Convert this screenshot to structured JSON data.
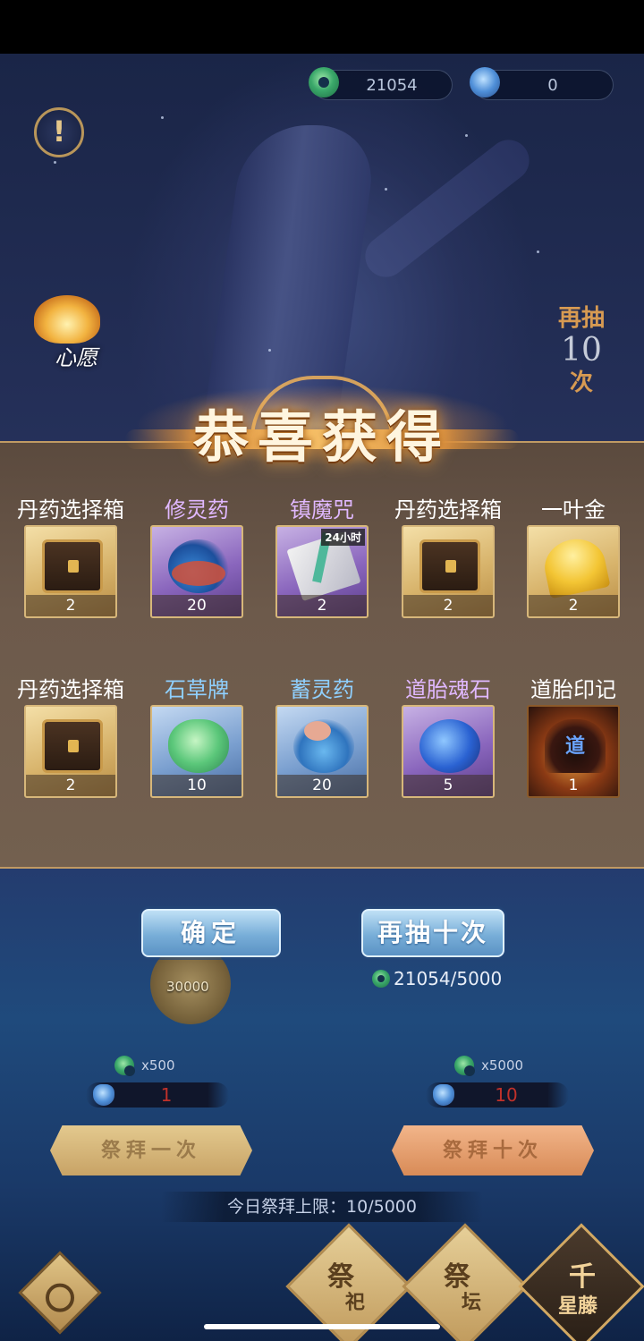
{
  "resources": {
    "jade_amount": "21054",
    "pouch_amount": "0"
  },
  "info_button": "!",
  "wish": {
    "label": "心愿"
  },
  "redraw_side": {
    "top": "再抽",
    "count": "10",
    "bottom": "次"
  },
  "result": {
    "title": "恭喜获得",
    "items": [
      {
        "name": "丹药选择箱",
        "count": "2",
        "rarity": "gold",
        "icon": "chest-icon"
      },
      {
        "name": "修灵药",
        "count": "20",
        "rarity": "purple",
        "icon": "potion-icon"
      },
      {
        "name": "镇魔咒",
        "count": "2",
        "rarity": "purple",
        "icon": "talisman-icon",
        "badge": "24小时"
      },
      {
        "name": "丹药选择箱",
        "count": "2",
        "rarity": "gold",
        "icon": "chest-icon"
      },
      {
        "name": "一叶金",
        "count": "2",
        "rarity": "gold",
        "icon": "ginkgo-leaf-icon"
      },
      {
        "name": "丹药选择箱",
        "count": "2",
        "rarity": "gold",
        "icon": "chest-icon"
      },
      {
        "name": "石草牌",
        "count": "10",
        "rarity": "blue",
        "icon": "jade-token-icon"
      },
      {
        "name": "蓄灵药",
        "count": "20",
        "rarity": "blue",
        "icon": "blue-potion-icon"
      },
      {
        "name": "道胎魂石",
        "count": "5",
        "rarity": "purple",
        "icon": "soul-stone-icon"
      },
      {
        "name": "道胎印记",
        "count": "1",
        "rarity": "dark",
        "icon": "dao-seal-icon"
      }
    ]
  },
  "actions": {
    "confirm": "确定",
    "redraw_ten": "再抽十次",
    "cost": "21054/5000"
  },
  "altar": {
    "coin_left": "30000",
    "price_one": "x500",
    "price_ten": "x5000",
    "pouch_one": "1",
    "pouch_ten": "10",
    "worship_one": "祭拜一次",
    "worship_ten": "祭拜十次",
    "daily_limit": "今日祭拜上限：10/5000"
  },
  "bottom_nav": [
    {
      "big": "祭",
      "small": "祀"
    },
    {
      "big": "祭",
      "small": "坛"
    },
    {
      "big": "千",
      "small": "星藤"
    }
  ],
  "colors": {
    "gold_frame": "#d7b77a",
    "purple_name": "#e0b8ff",
    "blue_name": "#8fd0ff",
    "panel_bg": "#6d5a4b"
  }
}
